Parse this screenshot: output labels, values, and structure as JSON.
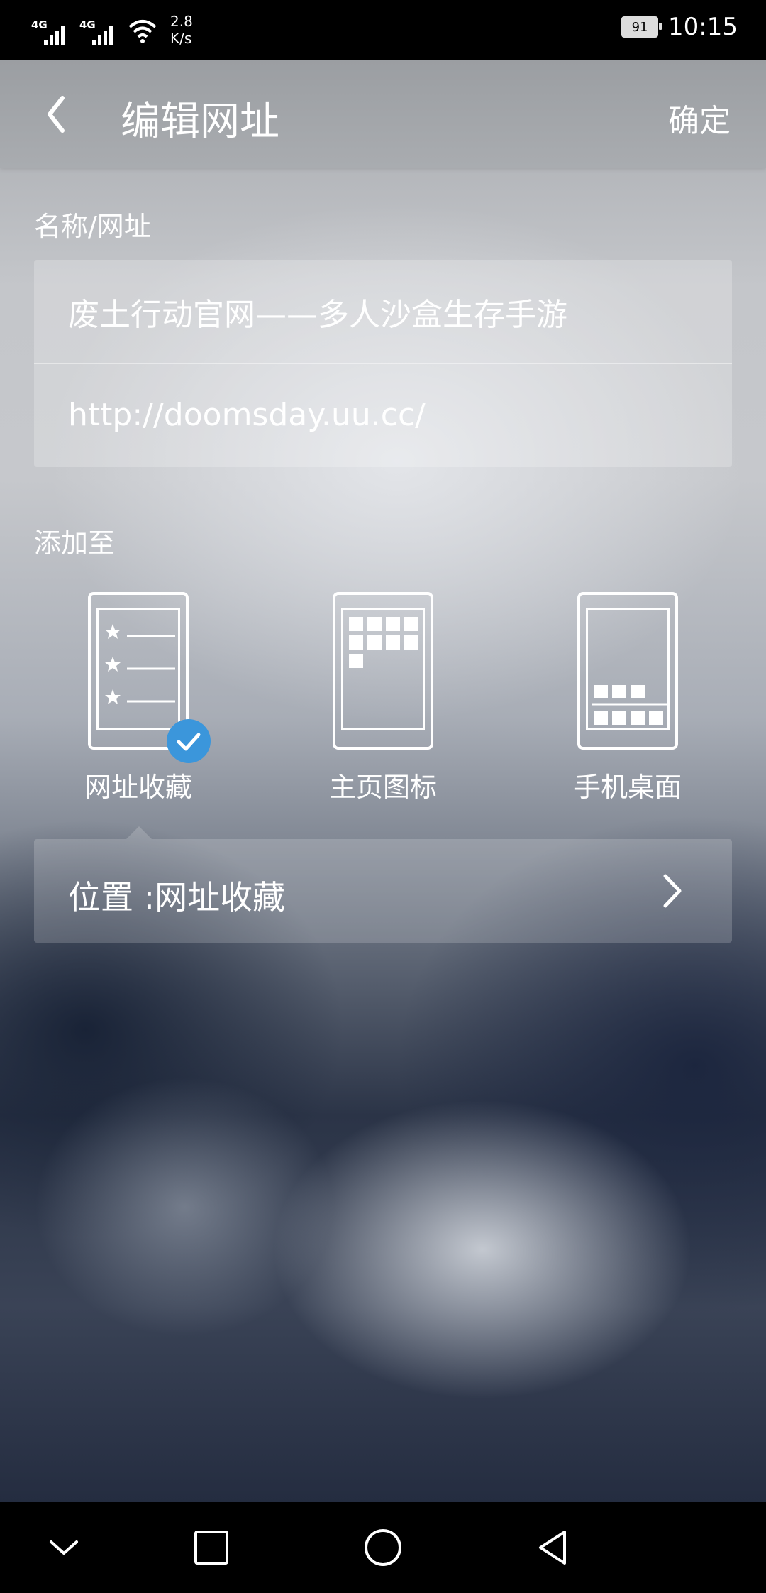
{
  "status_bar": {
    "signal1_label": "4G",
    "signal2_label": "4G",
    "speed_value": "2.8",
    "speed_unit": "K/s",
    "battery": "91",
    "time": "10:15"
  },
  "header": {
    "title": "编辑网址",
    "confirm_label": "确定"
  },
  "form": {
    "name_url_label": "名称/网址",
    "name_value": "废土行动官网——多人沙盒生存手游",
    "url_value": "http://doomsday.uu.cc/"
  },
  "add_to": {
    "label": "添加至",
    "options": [
      {
        "label": "网址收藏",
        "selected": true
      },
      {
        "label": "主页图标",
        "selected": false
      },
      {
        "label": "手机桌面",
        "selected": false
      }
    ]
  },
  "location": {
    "text": "位置 :网址收藏"
  },
  "colors": {
    "accent": "#3b96db"
  }
}
